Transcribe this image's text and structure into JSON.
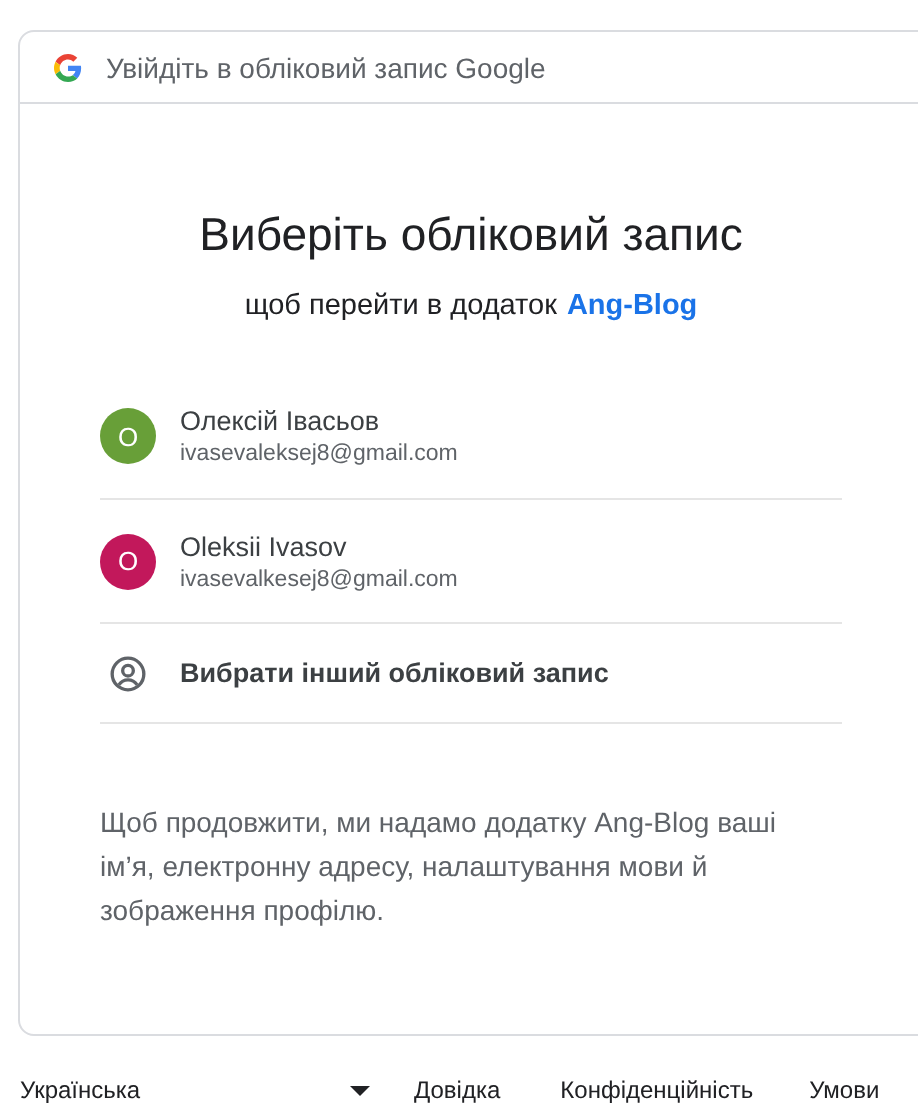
{
  "header": {
    "title": "Увійдіть в обліковий запис Google"
  },
  "heading": "Виберіть обліковий запис",
  "subtitle": {
    "text": "щоб перейти в додаток",
    "app": "Ang-Blog"
  },
  "accounts": [
    {
      "kind": "account",
      "initial": "O",
      "name": "Олексій Івасьов",
      "email": "ivasevaleksej8@gmail.com",
      "color": "#689f38"
    },
    {
      "kind": "account",
      "initial": "O",
      "name": "Oleksii Ivasov",
      "email": "ivasevalkesej8@gmail.com",
      "color": "#c2185b"
    },
    {
      "kind": "other",
      "name": "Вибрати інший обліковий запис"
    }
  ],
  "notice": "Щоб продовжити, ми надамо додатку Ang-Blog ваші ім’я, електронну адресу, налаштування мови й зображення профілю.",
  "footer": {
    "language": "Українська",
    "links": [
      "Довідка",
      "Конфіденційність",
      "Умови"
    ]
  }
}
